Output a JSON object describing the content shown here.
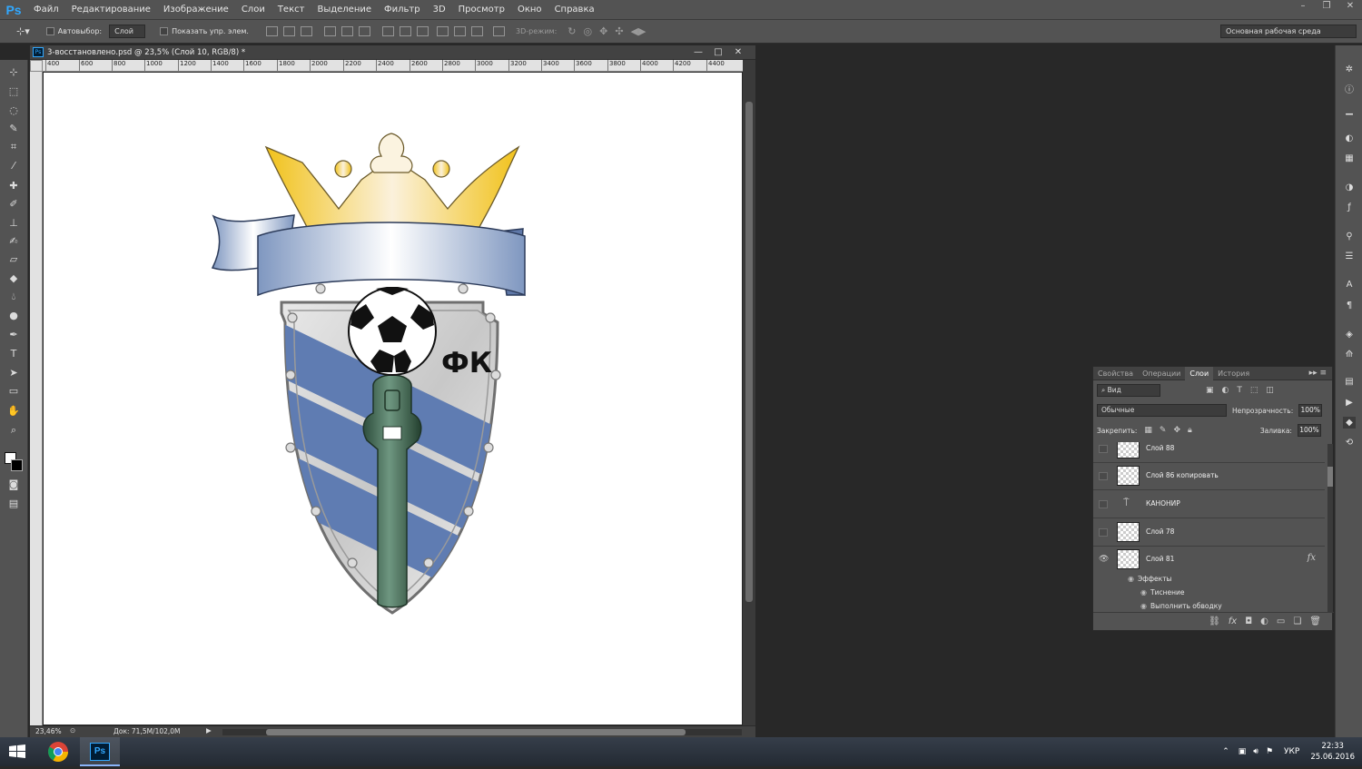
{
  "app": {
    "logo": "Ps"
  },
  "menu": [
    "Файл",
    "Редактирование",
    "Изображение",
    "Слои",
    "Текст",
    "Выделение",
    "Фильтр",
    "3D",
    "Просмотр",
    "Окно",
    "Справка"
  ],
  "options": {
    "autoselect_label": "Автовыбор:",
    "autoselect_value": "Слой",
    "show_transform_label": "Показать упр. элем.",
    "mode3d_label": "3D-режим:",
    "workspace": "Основная рабочая среда"
  },
  "document": {
    "tab_title": "3-восстановлено.psd @ 23,5% (Слой 10, RGB/8) *",
    "ruler_ticks": [
      "400",
      "600",
      "800",
      "1000",
      "1200",
      "1400",
      "1600",
      "1800",
      "2000",
      "2200",
      "2400",
      "2600",
      "2800",
      "3000",
      "3200",
      "3400",
      "3600",
      "3800",
      "4000",
      "4200",
      "4400"
    ],
    "artwork_text": "ФК",
    "zoom": "23,46%",
    "doc_size": "Док: 71,5M/102,0M"
  },
  "layers_panel": {
    "tabs": [
      "Свойства",
      "Операции",
      "Слои",
      "История"
    ],
    "active_tab": "Слои",
    "filter_label": "Вид",
    "blend_mode": "Обычные",
    "opacity_label": "Непрозрачность:",
    "opacity_value": "100%",
    "lock_label": "Закрепить:",
    "fill_label": "Заливка:",
    "fill_value": "100%",
    "layers": [
      {
        "name": "Слой 88",
        "visible": false
      },
      {
        "name": "Слой 86 копировать",
        "visible": false
      },
      {
        "name": "КАНОНИР",
        "visible": false
      },
      {
        "name": "Слой 78",
        "visible": false
      },
      {
        "name": "Слой 81",
        "visible": true,
        "fx": "fx"
      }
    ],
    "effects_label": "Эффекты",
    "effects": [
      "Тиснение",
      "Выполнить обводку"
    ]
  },
  "taskbar": {
    "lang": "УКР",
    "time": "22:33",
    "date": "25.06.2016",
    "ps_label": "Ps"
  }
}
